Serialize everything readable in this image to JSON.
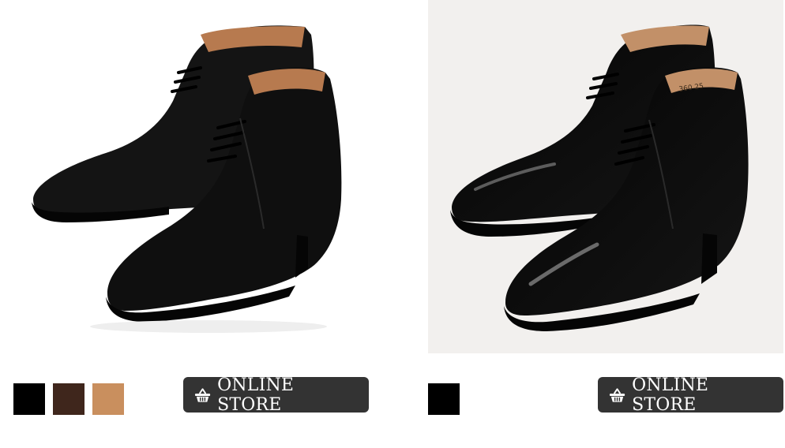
{
  "products": [
    {
      "swatches": [
        {
          "name": "black",
          "color": "#000000"
        },
        {
          "name": "dark-brown",
          "color": "#3f261c"
        },
        {
          "name": "tan",
          "color": "#c98f5e"
        }
      ],
      "store_button": {
        "label": "ONLINE STORE",
        "icon": "basket-icon"
      }
    },
    {
      "swatches": [
        {
          "name": "black",
          "color": "#000000"
        }
      ],
      "store_button": {
        "label": "ONLINE STORE",
        "icon": "basket-icon"
      }
    }
  ]
}
